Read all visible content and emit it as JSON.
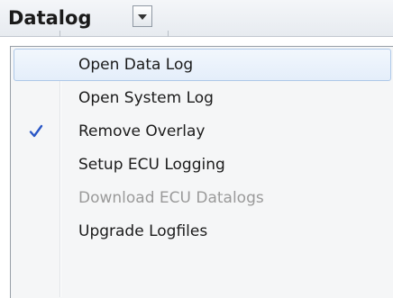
{
  "toolbar": {
    "title": "Datalog",
    "dropdown_icon": "chevron-down-icon"
  },
  "menu": {
    "items": [
      {
        "label": "Open Data Log",
        "checked": false,
        "enabled": true,
        "highlighted": true
      },
      {
        "label": "Open System Log",
        "checked": false,
        "enabled": true,
        "highlighted": false
      },
      {
        "label": "Remove Overlay",
        "checked": true,
        "enabled": true,
        "highlighted": false
      },
      {
        "label": "Setup ECU Logging",
        "checked": false,
        "enabled": true,
        "highlighted": false
      },
      {
        "label": "Download ECU Datalogs",
        "checked": false,
        "enabled": false,
        "highlighted": false
      },
      {
        "label": "Upgrade Logfiles",
        "checked": false,
        "enabled": true,
        "highlighted": false
      }
    ],
    "check_icon": "checkmark-icon",
    "colors": {
      "highlight_border": "#aec8e8",
      "check": "#2a57c6",
      "disabled_text": "#9a9a9a"
    }
  }
}
